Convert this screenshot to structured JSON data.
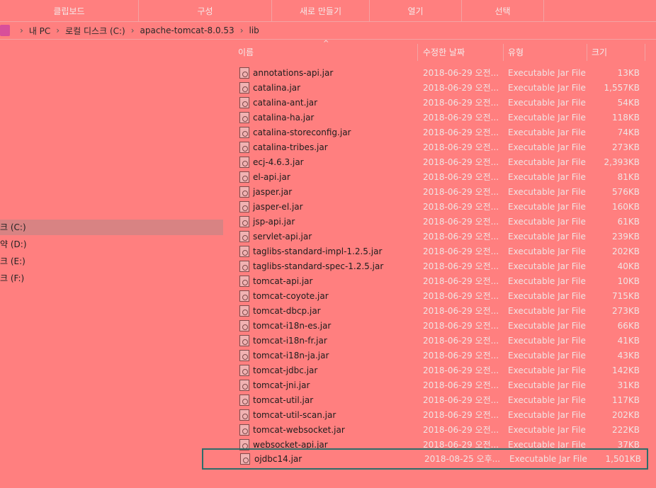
{
  "ribbon": {
    "groups": [
      {
        "label": "클립보드"
      },
      {
        "label": "구성"
      },
      {
        "label": "새로 만들기"
      },
      {
        "label": "열기"
      },
      {
        "label": "선택"
      }
    ]
  },
  "address": {
    "crumbs": [
      "내 PC",
      "로컬 디스크 (C:)",
      "apache-tomcat-8.0.53",
      "lib"
    ],
    "separator": "›"
  },
  "nav": {
    "items": [
      {
        "label": "크 (C:)",
        "selected": true
      },
      {
        "label": "약 (D:)",
        "selected": false
      },
      {
        "label": "크 (E:)",
        "selected": false
      },
      {
        "label": "크 (F:)",
        "selected": false
      }
    ]
  },
  "columns": {
    "name": "이름",
    "date": "수정한 날짜",
    "type": "유형",
    "size": "크기",
    "sort_indicator": "^"
  },
  "files": [
    {
      "name": "annotations-api.jar",
      "date": "2018-06-29 오전...",
      "type": "Executable Jar File",
      "size": "13KB"
    },
    {
      "name": "catalina.jar",
      "date": "2018-06-29 오전...",
      "type": "Executable Jar File",
      "size": "1,557KB"
    },
    {
      "name": "catalina-ant.jar",
      "date": "2018-06-29 오전...",
      "type": "Executable Jar File",
      "size": "54KB"
    },
    {
      "name": "catalina-ha.jar",
      "date": "2018-06-29 오전...",
      "type": "Executable Jar File",
      "size": "118KB"
    },
    {
      "name": "catalina-storeconfig.jar",
      "date": "2018-06-29 오전...",
      "type": "Executable Jar File",
      "size": "74KB"
    },
    {
      "name": "catalina-tribes.jar",
      "date": "2018-06-29 오전...",
      "type": "Executable Jar File",
      "size": "273KB"
    },
    {
      "name": "ecj-4.6.3.jar",
      "date": "2018-06-29 오전...",
      "type": "Executable Jar File",
      "size": "2,393KB"
    },
    {
      "name": "el-api.jar",
      "date": "2018-06-29 오전...",
      "type": "Executable Jar File",
      "size": "81KB"
    },
    {
      "name": "jasper.jar",
      "date": "2018-06-29 오전...",
      "type": "Executable Jar File",
      "size": "576KB"
    },
    {
      "name": "jasper-el.jar",
      "date": "2018-06-29 오전...",
      "type": "Executable Jar File",
      "size": "160KB"
    },
    {
      "name": "jsp-api.jar",
      "date": "2018-06-29 오전...",
      "type": "Executable Jar File",
      "size": "61KB"
    },
    {
      "name": "servlet-api.jar",
      "date": "2018-06-29 오전...",
      "type": "Executable Jar File",
      "size": "239KB"
    },
    {
      "name": "taglibs-standard-impl-1.2.5.jar",
      "date": "2018-06-29 오전...",
      "type": "Executable Jar File",
      "size": "202KB"
    },
    {
      "name": "taglibs-standard-spec-1.2.5.jar",
      "date": "2018-06-29 오전...",
      "type": "Executable Jar File",
      "size": "40KB"
    },
    {
      "name": "tomcat-api.jar",
      "date": "2018-06-29 오전...",
      "type": "Executable Jar File",
      "size": "10KB"
    },
    {
      "name": "tomcat-coyote.jar",
      "date": "2018-06-29 오전...",
      "type": "Executable Jar File",
      "size": "715KB"
    },
    {
      "name": "tomcat-dbcp.jar",
      "date": "2018-06-29 오전...",
      "type": "Executable Jar File",
      "size": "273KB"
    },
    {
      "name": "tomcat-i18n-es.jar",
      "date": "2018-06-29 오전...",
      "type": "Executable Jar File",
      "size": "66KB"
    },
    {
      "name": "tomcat-i18n-fr.jar",
      "date": "2018-06-29 오전...",
      "type": "Executable Jar File",
      "size": "41KB"
    },
    {
      "name": "tomcat-i18n-ja.jar",
      "date": "2018-06-29 오전...",
      "type": "Executable Jar File",
      "size": "43KB"
    },
    {
      "name": "tomcat-jdbc.jar",
      "date": "2018-06-29 오전...",
      "type": "Executable Jar File",
      "size": "142KB"
    },
    {
      "name": "tomcat-jni.jar",
      "date": "2018-06-29 오전...",
      "type": "Executable Jar File",
      "size": "31KB"
    },
    {
      "name": "tomcat-util.jar",
      "date": "2018-06-29 오전...",
      "type": "Executable Jar File",
      "size": "117KB"
    },
    {
      "name": "tomcat-util-scan.jar",
      "date": "2018-06-29 오전...",
      "type": "Executable Jar File",
      "size": "202KB"
    },
    {
      "name": "tomcat-websocket.jar",
      "date": "2018-06-29 오전...",
      "type": "Executable Jar File",
      "size": "222KB"
    },
    {
      "name": "websocket-api.jar",
      "date": "2018-06-29 오전...",
      "type": "Executable Jar File",
      "size": "37KB"
    },
    {
      "name": "ojdbc14.jar",
      "date": "2018-08-25 오후...",
      "type": "Executable Jar File",
      "size": "1,501KB",
      "selected": true
    }
  ]
}
